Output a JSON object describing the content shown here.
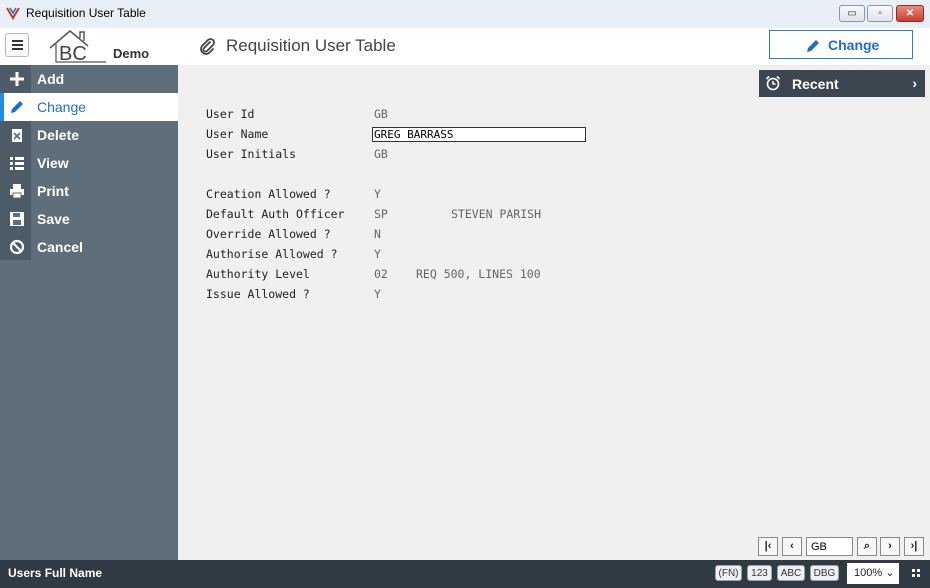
{
  "window": {
    "title": "Requisition User Table",
    "minimize_label": "▭",
    "maximize_label": "▫",
    "close_label": "✕"
  },
  "header": {
    "logo_text": "BC",
    "logo_subtext": "Demo",
    "page_title": "Requisition User Table",
    "change_button_label": "Change",
    "accent": "#1f6fc2"
  },
  "sidebar": {
    "items": [
      {
        "label": "Add",
        "icon": "plus-icon"
      },
      {
        "label": "Change",
        "icon": "pencil-icon",
        "active": true
      },
      {
        "label": "Delete",
        "icon": "delete-icon"
      },
      {
        "label": "View",
        "icon": "list-icon"
      },
      {
        "label": "Print",
        "icon": "printer-icon"
      },
      {
        "label": "Save",
        "icon": "save-icon"
      },
      {
        "label": "Cancel",
        "icon": "cancel-icon"
      }
    ]
  },
  "form": {
    "user_id": {
      "label": "User Id",
      "value": "GB"
    },
    "user_name": {
      "label": "User Name",
      "value": "GREG BARRASS"
    },
    "user_initials": {
      "label": "User Initials",
      "value": "GB"
    },
    "creation_allowed": {
      "label": "Creation Allowed ?",
      "value": "Y"
    },
    "default_auth_officer": {
      "label": "Default Auth Officer",
      "value": "SP",
      "name": "STEVEN PARISH"
    },
    "override_allowed": {
      "label": "Override Allowed ?",
      "value": "N"
    },
    "authorise_allowed": {
      "label": "Authorise Allowed ?",
      "value": "Y"
    },
    "authority_level": {
      "label": "Authority Level",
      "value": "02",
      "description": "REQ 500, LINES 100"
    },
    "issue_allowed": {
      "label": "Issue Allowed ?",
      "value": "Y"
    }
  },
  "recent": {
    "label": "Recent",
    "chevron": "›"
  },
  "navigation": {
    "first": "|‹",
    "prev": "‹",
    "record_value": "GB",
    "search": "⌕",
    "next": "›",
    "last": "›|"
  },
  "status": {
    "text": "Users Full Name",
    "chips": [
      "(FN)",
      "123",
      "ABC",
      "DBG"
    ],
    "zoom": "100% ⌄"
  }
}
